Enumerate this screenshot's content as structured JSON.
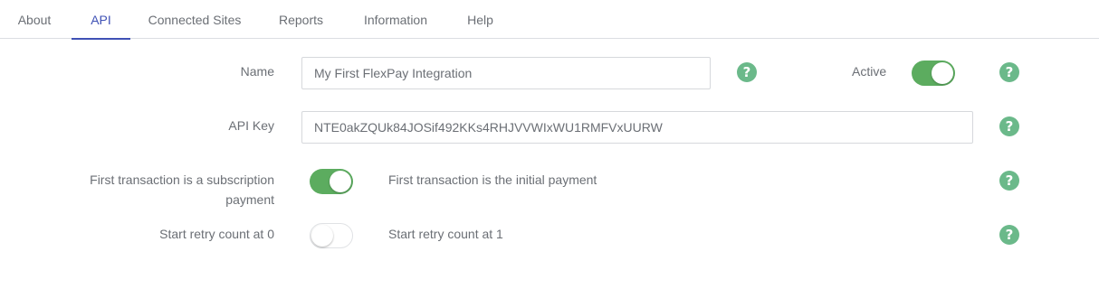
{
  "tabs": [
    {
      "label": "About"
    },
    {
      "label": "API"
    },
    {
      "label": "Connected Sites"
    },
    {
      "label": "Reports"
    },
    {
      "label": "Information"
    },
    {
      "label": "Help"
    }
  ],
  "active_tab": "API",
  "form": {
    "name_label": "Name",
    "name_value": "My First FlexPay Integration",
    "active_label": "Active",
    "active_on": true,
    "api_key_label": "API Key",
    "api_key_value": "NTE0akZQUk84JOSif492KKs4RHJVVWIxWU1RMFVxUURW",
    "subscription_label_line1": "First transaction is a subscription",
    "subscription_label_line2": "payment",
    "subscription_toggle_on": true,
    "subscription_alt_label": "First transaction is the initial payment",
    "retry_label": "Start retry count at 0",
    "retry_toggle_on": false,
    "retry_alt_label": "Start retry count at 1"
  },
  "icons": {
    "help": "question-circle-icon",
    "help_glyph": "?"
  },
  "colors": {
    "accent": "#3f51b5",
    "toggle_on": "#5cac5f",
    "help_icon": "#6bb98a"
  }
}
